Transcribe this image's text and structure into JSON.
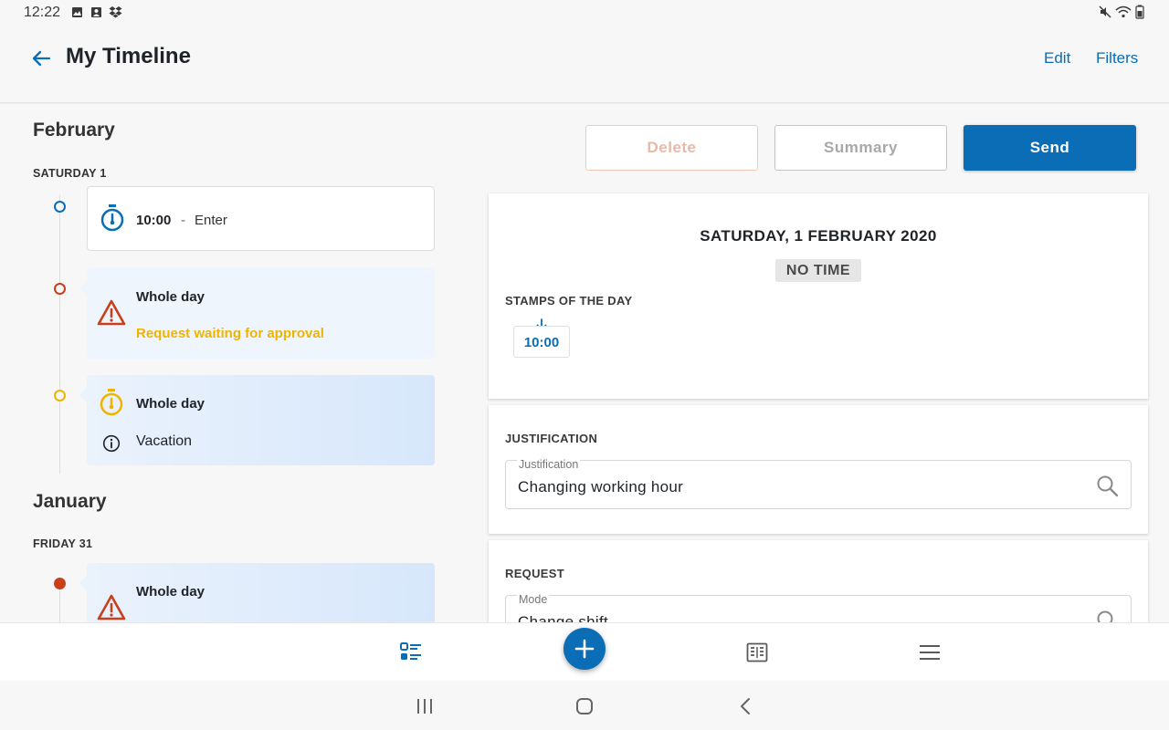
{
  "status_bar": {
    "time": "12:22"
  },
  "header": {
    "title": "My Timeline",
    "edit_label": "Edit",
    "filters_label": "Filters"
  },
  "actions": {
    "delete_label": "Delete",
    "summary_label": "Summary",
    "send_label": "Send"
  },
  "timeline": {
    "groups": [
      {
        "month": "February",
        "day": "SATURDAY 1",
        "entries": [
          {
            "time": "10:00",
            "separator": "-",
            "type": "Enter"
          },
          {
            "title": "Whole day",
            "status": "Request waiting for approval"
          },
          {
            "title": "Whole day",
            "subtitle": "Vacation"
          }
        ]
      },
      {
        "month": "January",
        "day": "FRIDAY 31",
        "entries": [
          {
            "title": "Whole day"
          }
        ]
      }
    ]
  },
  "detail": {
    "date_heading": "SATURDAY, 1 FEBRUARY 2020",
    "no_time_badge": "NO TIME",
    "stamps_label": "STAMPS OF THE DAY",
    "stamp_time": "10:00",
    "justification_section": "JUSTIFICATION",
    "justification_field_label": "Justification",
    "justification_value": "Changing working hour",
    "request_section": "REQUEST",
    "mode_field_label": "Mode",
    "mode_value": "Change shift"
  },
  "colors": {
    "accent": "#0a6db6",
    "warning": "#c8401a",
    "pending": "#f0b400",
    "delete_text": "#e8b9a6",
    "send_bg": "#0a6db6"
  }
}
